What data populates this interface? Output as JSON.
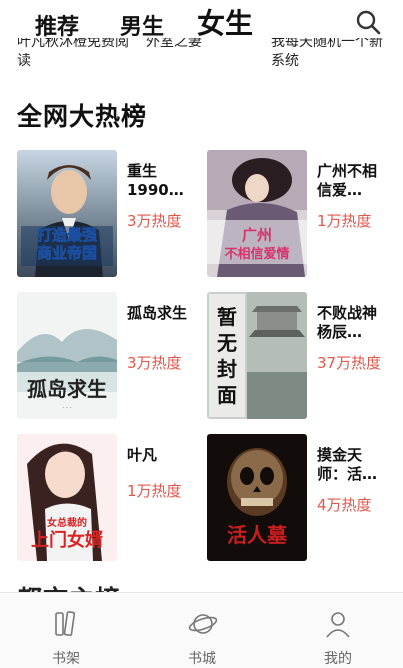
{
  "top_tabs": [
    {
      "label": "推荐"
    },
    {
      "label": "男生"
    },
    {
      "label": "女生",
      "active": true
    }
  ],
  "prev_row": [
    {
      "text": "叶凡秋沐橙免费阅读"
    },
    {
      "text": "外室之妻"
    },
    {
      "text": "我每天随机一个新系统"
    }
  ],
  "section": {
    "title": "全网大热榜"
  },
  "books": [
    {
      "title": "重生1990…",
      "heat": "3万热度",
      "cover_text": "打造最强商业帝国"
    },
    {
      "title": "广州不相信爱…",
      "heat": "1万热度",
      "cover_text": "广州不相信爱情"
    },
    {
      "title": "孤岛求生",
      "heat": "3万热度",
      "cover_text": "孤岛求生"
    },
    {
      "title": "不败战神杨辰…",
      "heat": "37万热度",
      "cover_text": "暂无封面"
    },
    {
      "title": "叶凡",
      "heat": "1万热度",
      "cover_text": "上门女婿"
    },
    {
      "title": "摸金天师：活…",
      "heat": "4万热度",
      "cover_text": "活人墓"
    }
  ],
  "next_section": {
    "title": "都市主榜"
  },
  "bottom_nav": [
    {
      "label": "书架",
      "icon": "bookshelf-icon"
    },
    {
      "label": "书城",
      "icon": "planet-icon"
    },
    {
      "label": "我的",
      "icon": "user-icon"
    }
  ],
  "colors": {
    "accent": "#e2574c",
    "text": "#111111",
    "nav_text": "#666666"
  }
}
